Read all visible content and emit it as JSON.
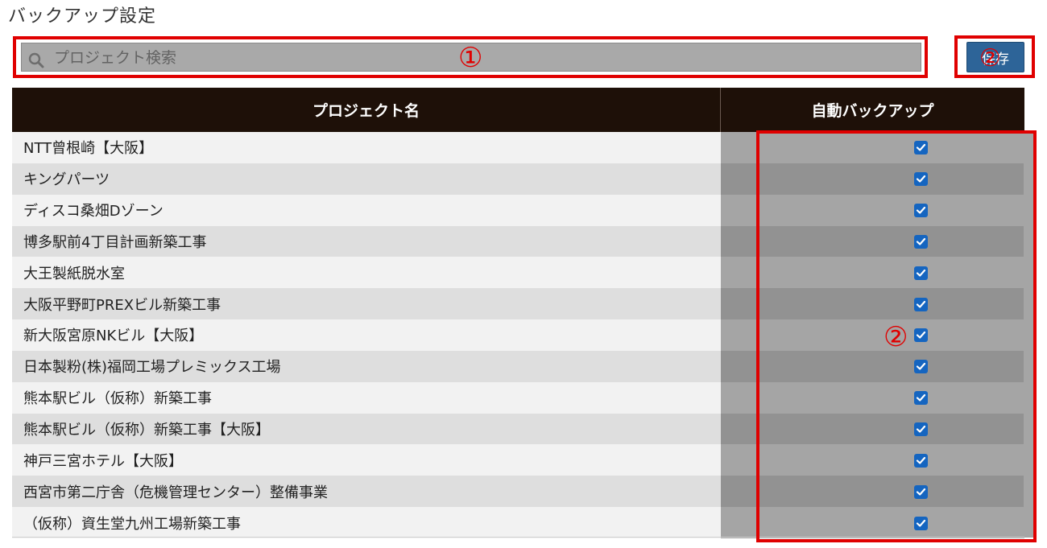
{
  "page": {
    "title": "バックアップ設定"
  },
  "search": {
    "placeholder": "プロジェクト検索",
    "value": ""
  },
  "toolbar": {
    "save_label": "保存"
  },
  "annotations": {
    "marker_1": "①",
    "marker_2": "②",
    "marker_3": "②"
  },
  "table": {
    "headers": {
      "name": "プロジェクト名",
      "auto_backup": "自動バックアップ"
    },
    "rows": [
      {
        "name": "NTT曾根崎【大阪】",
        "auto_backup": true
      },
      {
        "name": "キングパーツ",
        "auto_backup": true
      },
      {
        "name": "ディスコ桑畑Dゾーン",
        "auto_backup": true
      },
      {
        "name": "博多駅前4丁目計画新築工事",
        "auto_backup": true
      },
      {
        "name": "大王製紙脱水室",
        "auto_backup": true
      },
      {
        "name": "大阪平野町PREXビル新築工事",
        "auto_backup": true
      },
      {
        "name": "新大阪宮原NKビル【大阪】",
        "auto_backup": true
      },
      {
        "name": "日本製粉(株)福岡工場プレミックス工場",
        "auto_backup": true
      },
      {
        "name": "熊本駅ビル（仮称）新築工事",
        "auto_backup": true
      },
      {
        "name": "熊本駅ビル（仮称）新築工事【大阪】",
        "auto_backup": true
      },
      {
        "name": "神戸三宮ホテル【大阪】",
        "auto_backup": true
      },
      {
        "name": "西宮市第二庁舎（危機管理センター）整備事業",
        "auto_backup": true
      },
      {
        "name": "（仮称）資生堂九州工場新築工事",
        "auto_backup": true
      }
    ]
  },
  "colors": {
    "header_bg": "#1e1008",
    "save_button": "#2d6498",
    "checkbox": "#1565c0",
    "annotation_red": "#e00000"
  }
}
